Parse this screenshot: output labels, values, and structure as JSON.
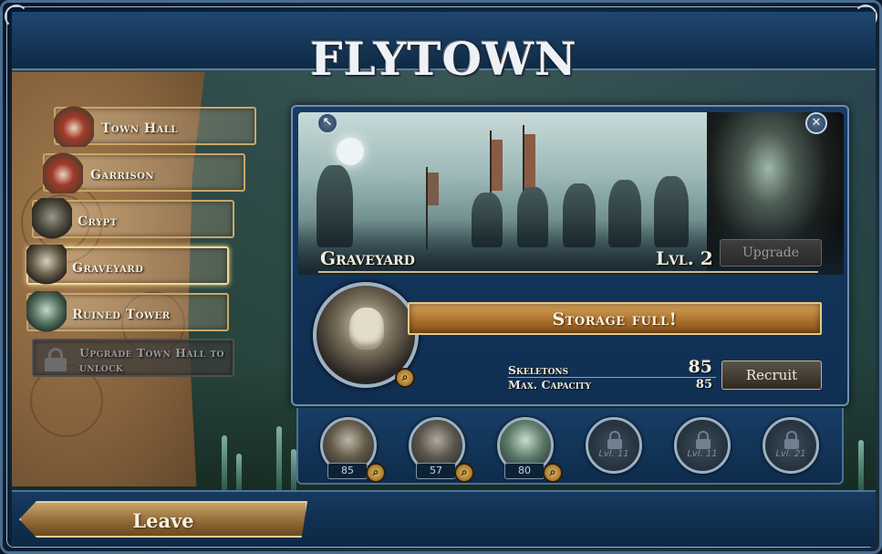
{
  "town": {
    "title": "FLYTOWN"
  },
  "menu": {
    "items": [
      {
        "label": "Town Hall",
        "icon": "town-hall-icon",
        "state": "normal"
      },
      {
        "label": "Garrison",
        "icon": "garrison-icon",
        "state": "normal"
      },
      {
        "label": "Crypt",
        "icon": "crypt-icon",
        "state": "normal"
      },
      {
        "label": "Graveyard",
        "icon": "graveyard-icon",
        "state": "selected"
      },
      {
        "label": "Ruined Tower",
        "icon": "ruined-tower-icon",
        "state": "normal"
      },
      {
        "label": "Upgrade Town Hall to unlock",
        "icon": "lock-icon",
        "state": "locked"
      }
    ]
  },
  "building": {
    "name": "Graveyard",
    "level": "Lvl. 2",
    "upgrade_label": "Upgrade",
    "storage_status": "Storage full!",
    "unit_label": "Skeletons",
    "unit_count": "85",
    "capacity_label": "Max. Capacity",
    "capacity_value": "85",
    "recruit_label": "Recruit"
  },
  "units": [
    {
      "count": "85",
      "type": "skeleton"
    },
    {
      "count": "57",
      "type": "ghoul"
    },
    {
      "count": "80",
      "type": "banshee"
    }
  ],
  "locked_units": [
    {
      "label": "Lvl. 11"
    },
    {
      "label": "Lvl. 11"
    },
    {
      "label": "Lvl. 21"
    }
  ],
  "footer": {
    "leave_label": "Leave"
  },
  "colors": {
    "panel_blue": "#173b63",
    "parchment": "#a57c4e",
    "storage_orange": "#a86d2a",
    "frame_border": "#6b8fb4"
  }
}
